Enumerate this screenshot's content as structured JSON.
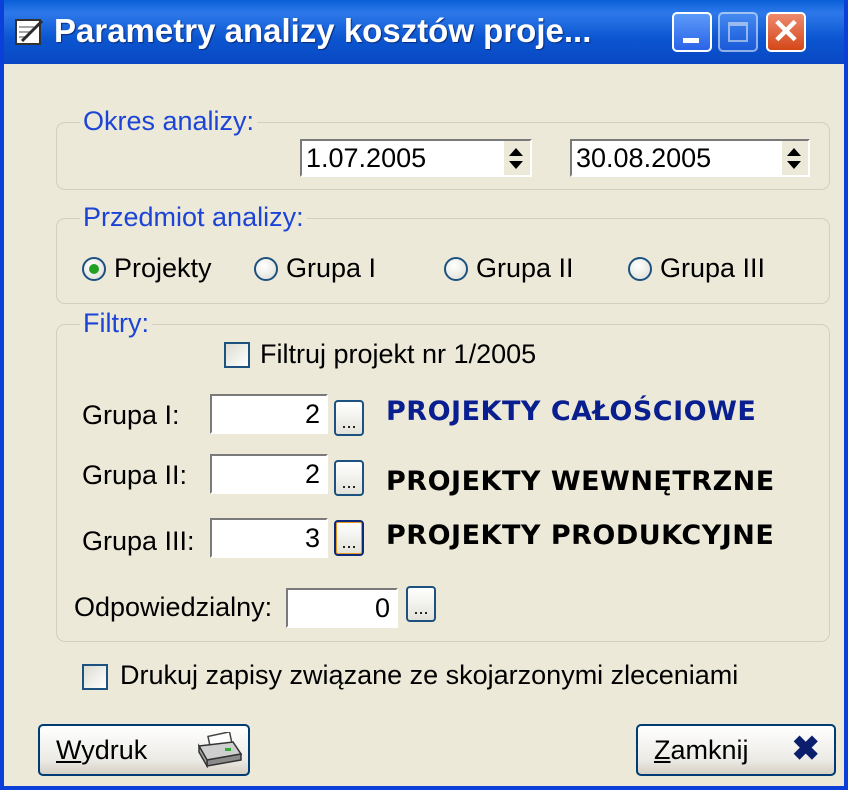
{
  "window": {
    "title": "Parametry analizy kosztów proje..."
  },
  "period": {
    "legend": "Okres analizy:",
    "from": "1.07.2005",
    "to": "30.08.2005"
  },
  "subject": {
    "legend": "Przedmiot analizy:",
    "options": [
      "Projekty",
      "Grupa I",
      "Grupa II",
      "Grupa III"
    ],
    "selected": "Projekty"
  },
  "filters": {
    "legend": "Filtry:",
    "filter_project_label": "Filtruj projekt nr 1/2005",
    "filter_project_checked": false,
    "groups": [
      {
        "label": "Grupa I:",
        "value": "2",
        "name": "PROJEKTY CAŁOŚCIOWE",
        "color": "#0a1f8f"
      },
      {
        "label": "Grupa II:",
        "value": "2",
        "name": "PROJEKTY WEWNĘTRZNE",
        "color": "#000000"
      },
      {
        "label": "Grupa III:",
        "value": "3",
        "name": "PROJEKTY PRODUKCYJNE",
        "color": "#000000"
      }
    ],
    "responsible_label": "Odpowiedzialny:",
    "responsible_value": "0",
    "browse_label": "..."
  },
  "print_related": {
    "label": "Drukuj zapisy związane ze skojarzonymi zleceniami",
    "checked": false
  },
  "buttons": {
    "print": "Wydruk",
    "close": "Zamknij"
  },
  "icons": {
    "app": "notepad-pen-icon",
    "print": "printer-icon",
    "close": "close-x-icon"
  },
  "colors": {
    "titlebar": "#0a5fd6",
    "legend": "#1c44d6",
    "radio_selected": "#21a121"
  }
}
